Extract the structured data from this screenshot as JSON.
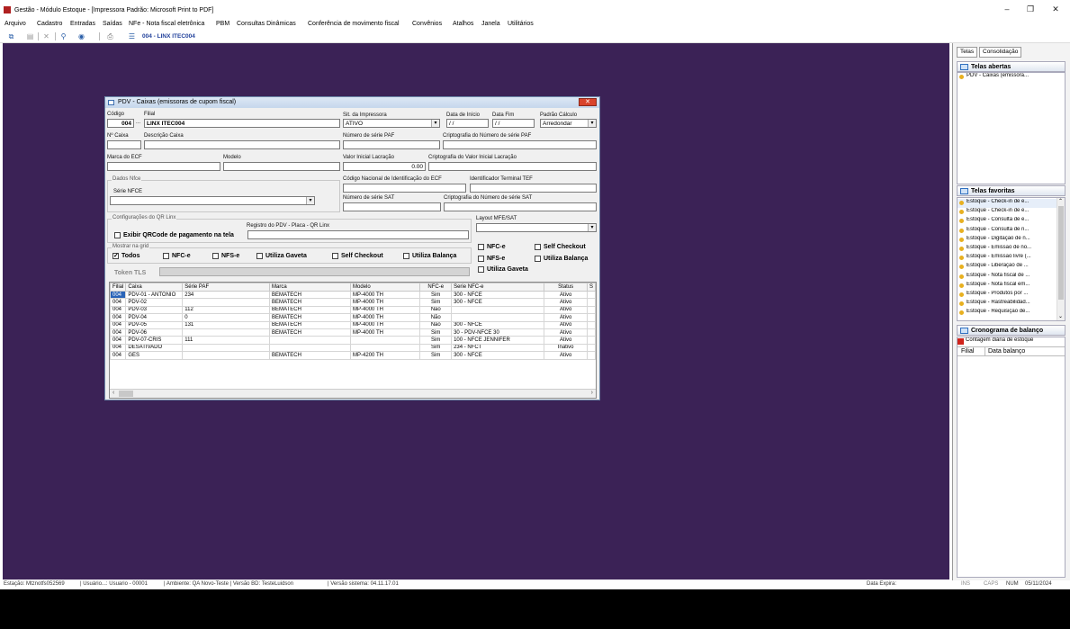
{
  "window": {
    "title": "Gestão - Módulo Estoque - [Impressora Padrão: Microsoft Print to PDF]",
    "controls": {
      "minimize": "–",
      "maximize": "❐",
      "close": "✕"
    }
  },
  "menu": [
    "Arquivo",
    "Cadastro",
    "Entradas",
    "Saídas",
    "NFe - Nota fiscal eletrônica",
    "PBM",
    "Consultas Dinâmicas",
    "Conferência de movimento fiscal",
    "Convênios",
    "Atalhos",
    "Janela",
    "Utilitários"
  ],
  "toolbar": {
    "company_label": "004 - LINX ITEC004"
  },
  "dialog": {
    "title": "PDV - Caixas (emissoras de cupom fiscal)",
    "close": "✕",
    "fields": {
      "codigo_label": "Código",
      "codigo": "004",
      "filial_label": "Filial",
      "filial": "LINX ITEC004",
      "sit_label": "Sit. da Impressora",
      "sit": "ATIVO",
      "data_inicio_label": "Data de Início",
      "data_inicio": "/ /",
      "data_fim_label": "Data Fim",
      "data_fim": "/ /",
      "padrao_calculo_label": "Padrão Cálculo",
      "padrao_calculo": "Arredondar",
      "nr_caixa_label": "Nº Caixa",
      "descricao_label": "Descrição Caixa",
      "serie_paf_label": "Número de série PAF",
      "cripto_serie_paf_label": "Criptografia do Número de série PAF",
      "marca_ecf_label": "Marca do ECF",
      "modelo_label": "Modelo",
      "valor_lacracao_label": "Valor Inicial Lacração",
      "valor_lacracao": "0.00",
      "cripto_valor_label": "Criptografia do Valor Inicial Lacração",
      "dados_nfce_label": "Dados Nfce",
      "codigo_nacional_label": "Código Nacional de Identificação do ECF",
      "identificador_tef_label": "Identificador Terminal TEF",
      "serie_nfce_label": "Série NFCE",
      "serie_sat_label": "Número de série SAT",
      "cripto_sat_label": "Criptografia do Número de série SAT",
      "qr_group_label": "Configurações do QR Linx",
      "registro_pdv_label": "Registro do PDV - Placa - QR Linx",
      "exibir_qr_label": "Exibir QRCode de pagamento na tela",
      "layout_mfe_label": "Layout MFE/SAT",
      "mostrar_grid_label": "Mostrar na grid",
      "token_label": "Token TLS"
    },
    "grid_checks": [
      {
        "label": "Todos",
        "checked": true
      },
      {
        "label": "NFC-e",
        "checked": false
      },
      {
        "label": "NFS-e",
        "checked": false
      },
      {
        "label": "Utiliza Gaveta",
        "checked": false
      },
      {
        "label": "Self Checkout",
        "checked": false
      },
      {
        "label": "Utiliza Balança",
        "checked": false
      }
    ],
    "side_checks": [
      "NFC-e",
      "Self Checkout",
      "NFS-e",
      "Utiliza Balança",
      "Utiliza Gaveta"
    ],
    "table": {
      "headers": [
        "Filial",
        "Caixa",
        "Série PAF",
        "Marca",
        "Modelo",
        "NFC-e",
        "Serie NFC-e",
        "Status",
        "S"
      ],
      "rows": [
        [
          "004",
          "PDV-01 - ANTONIO",
          "234",
          "BEMATECH",
          "MP-4000 TH",
          "Sim",
          "300 - NFCE",
          "Ativo",
          ""
        ],
        [
          "004",
          "PDV-02",
          "",
          "BEMATECH",
          "MP-4000 TH",
          "Sim",
          "300 - NFCE",
          "Ativo",
          ""
        ],
        [
          "004",
          "PDV-03",
          "112",
          "BEMATECH",
          "MP-4000 TH",
          "Não",
          "",
          "Ativo",
          ""
        ],
        [
          "004",
          "PDV-04",
          "0",
          "BEMATECH",
          "MP-4000 TH",
          "Não",
          "",
          "Ativo",
          ""
        ],
        [
          "004",
          "PDV-05",
          "131",
          "BEMATECH",
          "MP-4000 TH",
          "Não",
          "300 - NFCE",
          "Ativo",
          ""
        ],
        [
          "004",
          "PDV-06",
          "",
          "BEMATECH",
          "MP-4000 TH",
          "Sim",
          "30 - PDV-NFCE 30",
          "Ativo",
          ""
        ],
        [
          "004",
          "PDV-07-CRIS",
          "111",
          "",
          "",
          "Sim",
          "100 - NFCE JENNIFER",
          "Ativo",
          ""
        ],
        [
          "004",
          "DESATIVADO",
          "",
          "",
          "",
          "Sim",
          "234 - NFCT",
          "Inativo",
          ""
        ],
        [
          "004",
          "GES",
          "",
          "BEMATECH",
          "MP-4200 TH",
          "Sim",
          "300 - NFCE",
          "Ativo",
          ""
        ]
      ]
    }
  },
  "right_panel": {
    "tabs": [
      "Telas",
      "Consolidação"
    ],
    "open_title": "Telas abertas",
    "open_items": [
      "PDV - Caixas (emissora..."
    ],
    "fav_title": "Telas favoritas",
    "fav_items": [
      "Estoque - Check-in de e...",
      "Estoque - Check-in de e...",
      "Estoque - Consulta de e...",
      "Estoque - Consulta de n...",
      "Estoque - Digitação de n...",
      "Estoque - Emissão de no...",
      "Estoque - Emissão livre (...",
      "Estoque - Liberação de ...",
      "Estoque - Nota fiscal de ...",
      "Estoque - Nota fiscal em...",
      "Estoque - Produtos por ...",
      "Estoque - Rastreabilidad...",
      "Estoque - Requisição de..."
    ],
    "crono_title": "Cronograma de balanço",
    "crono_item": "Contagem diária de estoque",
    "crono_headers": [
      "Filial",
      "Data balanço"
    ]
  },
  "status": {
    "estacao": "Estação: Mtznotfs052569",
    "usuario": "| Usuário...: Usuario - 00001",
    "ambiente": "| Ambiente: QA Novo-Teste | Versão BD: TesteLuidson",
    "versao": "| Versão sistema: 04.11.17.01",
    "data_expira": "Data Expira:",
    "ins": "INS",
    "caps": "CAPS",
    "num": "NUM",
    "date": "05/11/2024"
  }
}
